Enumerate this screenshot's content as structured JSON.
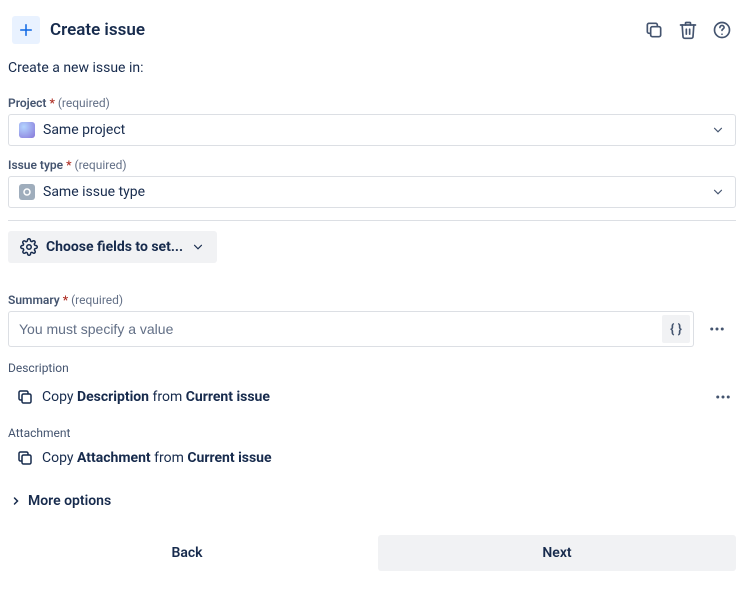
{
  "header": {
    "title": "Create issue"
  },
  "subtitle": "Create a new issue in:",
  "fields": {
    "project": {
      "label": "Project",
      "required_text": "(required)",
      "value": "Same project"
    },
    "issueType": {
      "label": "Issue type",
      "required_text": "(required)",
      "value": "Same issue type"
    },
    "summary": {
      "label": "Summary",
      "required_text": "(required)",
      "placeholder": "You must specify a value",
      "value": ""
    }
  },
  "chooseFields": "Choose fields to set...",
  "description": {
    "label": "Description",
    "copy_prefix": "Copy ",
    "copy_bold1": "Description",
    "copy_mid": " from ",
    "copy_bold2": "Current issue"
  },
  "attachment": {
    "label": "Attachment",
    "copy_prefix": "Copy ",
    "copy_bold1": "Attachment",
    "copy_mid": " from ",
    "copy_bold2": "Current issue"
  },
  "moreOptions": "More options",
  "footer": {
    "back": "Back",
    "next": "Next"
  },
  "glyphs": {
    "braces": "{ }"
  }
}
